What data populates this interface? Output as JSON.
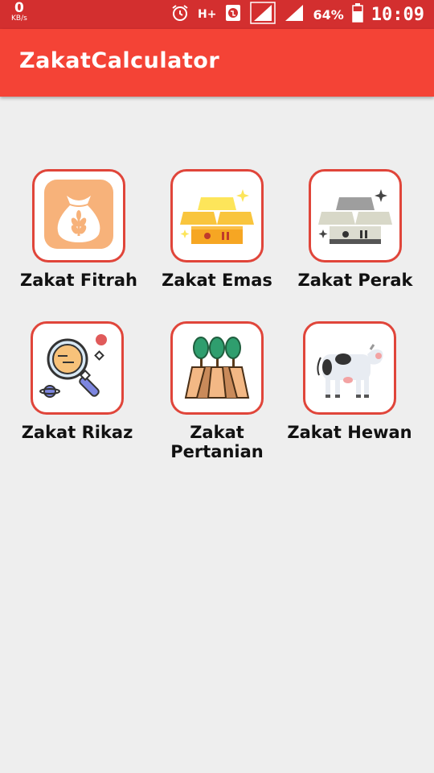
{
  "status": {
    "speed": "0",
    "speed_unit": "KB/s",
    "network": "H+",
    "battery": "64%",
    "time": "10:09"
  },
  "app": {
    "title": "ZakatCalculator"
  },
  "menu": [
    {
      "label": "Zakat Fitrah"
    },
    {
      "label": "Zakat Emas"
    },
    {
      "label": "Zakat Perak"
    },
    {
      "label": "Zakat Rikaz"
    },
    {
      "label": "Zakat Pertanian"
    },
    {
      "label": "Zakat Hewan"
    }
  ],
  "colors": {
    "status_bar": "#d32f2f",
    "app_bar": "#f44336",
    "tile_border": "#e0453a",
    "background": "#eeeeee"
  },
  "icons": [
    "rice-sack-icon",
    "gold-bars-icon",
    "silver-bars-icon",
    "magnifier-treasure-icon",
    "farm-field-icon",
    "cow-icon"
  ]
}
